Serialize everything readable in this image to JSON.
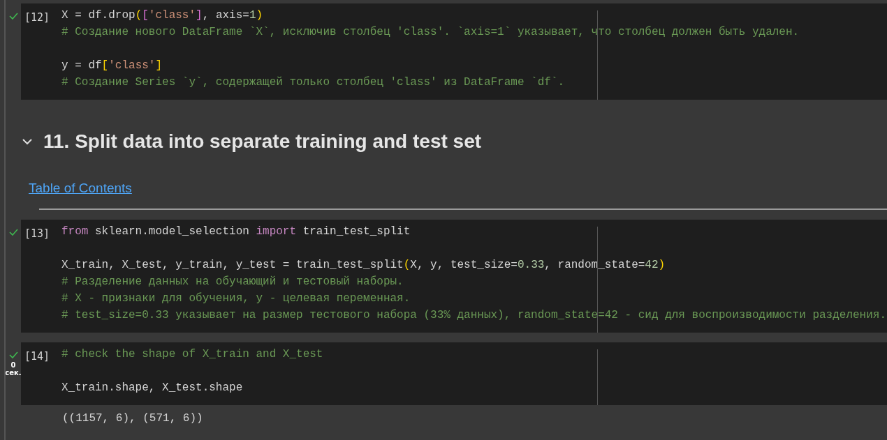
{
  "cells": [
    {
      "kind": "code",
      "prompt": "[12]",
      "executed": true,
      "blocks": [
        [
          {
            "tokens": [
              {
                "kind": "plain",
                "t": "X = df.drop"
              },
              {
                "kind": "paren",
                "t": "("
              },
              {
                "kind": "paren2",
                "t": "["
              },
              {
                "kind": "string",
                "t": "'class'"
              },
              {
                "kind": "paren2",
                "t": "]"
              },
              {
                "kind": "plain",
                "t": ", axis="
              },
              {
                "kind": "number",
                "t": "1"
              },
              {
                "kind": "paren",
                "t": ")"
              }
            ]
          },
          {
            "tokens": [
              {
                "kind": "comment",
                "t": "# Создание нового DataFrame `X`, исключив столбец 'class'. `axis=1` указывает, что столбец должен быть удален."
              }
            ]
          }
        ],
        [
          {
            "tokens": [
              {
                "kind": "plain",
                "t": "y = df"
              },
              {
                "kind": "paren",
                "t": "["
              },
              {
                "kind": "string",
                "t": "'class'"
              },
              {
                "kind": "paren",
                "t": "]"
              }
            ]
          },
          {
            "tokens": [
              {
                "kind": "comment",
                "t": "# Создание Series `y`, содержащей только столбец 'class' из DataFrame `df`."
              }
            ]
          }
        ]
      ]
    },
    {
      "kind": "markdown",
      "heading": "11. Split data into separate training and test set",
      "expanded": true,
      "link": "Table of Contents"
    },
    {
      "kind": "code",
      "prompt": "[13]",
      "executed": true,
      "blocks": [
        [
          {
            "tokens": [
              {
                "kind": "keyword",
                "t": "from"
              },
              {
                "kind": "plain",
                "t": " sklearn.model_selection "
              },
              {
                "kind": "keyword",
                "t": "import"
              },
              {
                "kind": "plain",
                "t": " train_test_split"
              }
            ]
          }
        ],
        [
          {
            "tokens": [
              {
                "kind": "plain",
                "t": "X_train, X_test, y_train, y_test = train_test_split"
              },
              {
                "kind": "paren",
                "t": "("
              },
              {
                "kind": "plain",
                "t": "X, y, test_size="
              },
              {
                "kind": "number",
                "t": "0.33"
              },
              {
                "kind": "plain",
                "t": ", random_state="
              },
              {
                "kind": "number",
                "t": "42"
              },
              {
                "kind": "paren",
                "t": ")"
              }
            ]
          },
          {
            "tokens": [
              {
                "kind": "comment",
                "t": "# Разделение данных на обучающий и тестовый наборы."
              }
            ]
          },
          {
            "tokens": [
              {
                "kind": "comment",
                "t": "# X - признаки для обучения, y - целевая переменная."
              }
            ]
          },
          {
            "tokens": [
              {
                "kind": "comment",
                "t": "# test_size=0.33 указывает на размер тестового набора (33% данных), random_state=42 - сид для воспроизводимости разделения."
              }
            ]
          }
        ]
      ]
    },
    {
      "kind": "code",
      "prompt": "[14]",
      "executed": true,
      "duration": "0",
      "duration_unit": "сек.",
      "blocks": [
        [
          {
            "tokens": [
              {
                "kind": "comment",
                "t": "# check the shape of X_train and X_test"
              }
            ]
          }
        ],
        [
          {
            "tokens": [
              {
                "kind": "plain",
                "t": "X_train.shape, X_test.shape"
              }
            ]
          }
        ]
      ],
      "output": "((1157, 6), (571, 6))"
    }
  ]
}
